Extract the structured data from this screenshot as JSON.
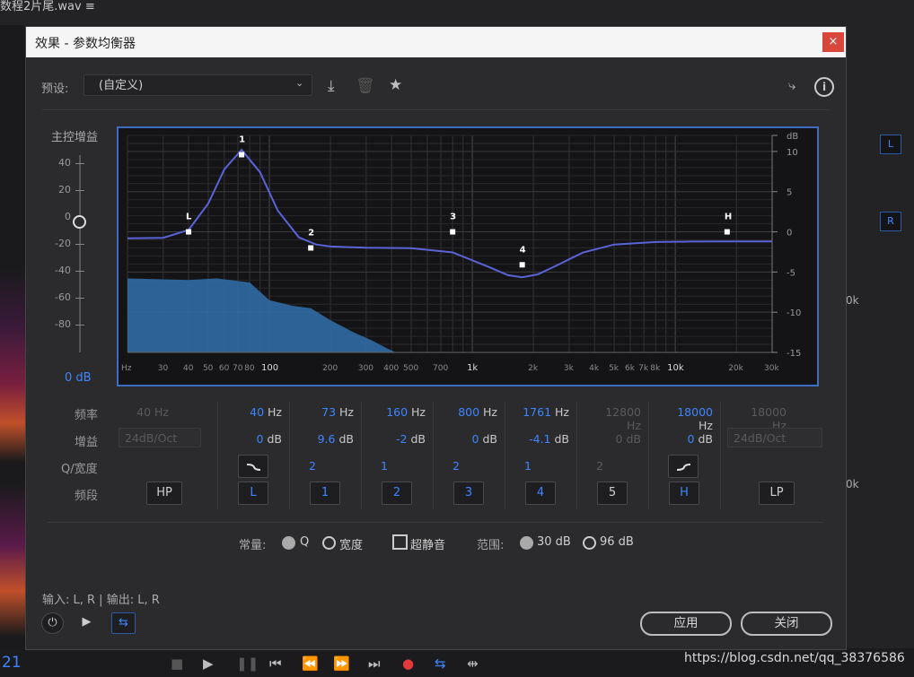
{
  "background": {
    "file_title": "数程2片尾.wav ≡",
    "counter": "21",
    "right_badges": [
      "L",
      "R"
    ],
    "right_values": [
      "0k",
      "0k"
    ],
    "transport": [
      "■",
      "▶",
      "❚❚",
      "⏮",
      "⏪",
      "⏩",
      "⏭",
      "●",
      "⇆",
      "⇹"
    ],
    "watermark": "https://blog.csdn.net/qq_38376586"
  },
  "dialog": {
    "title": "效果 - 参数均衡器",
    "close_label": "×",
    "preset_label": "预设:",
    "preset_value": "(自定义)",
    "master_gain_label": "主控增益",
    "master_ticks": [
      "40",
      "20",
      "0",
      "-20",
      "-40",
      "-60",
      "-80"
    ],
    "master_value": "0 dB"
  },
  "graph": {
    "freq_ticks": [
      "Hz",
      "30",
      "40",
      "50",
      "60",
      "70",
      "80",
      "100",
      "200",
      "300",
      "400",
      "500",
      "700",
      "1k",
      "2k",
      "3k",
      "4k",
      "5k",
      "6k",
      "7k",
      "8k",
      "10k",
      "20k",
      "30k"
    ],
    "db_ticks": [
      "dB",
      "10",
      "5",
      "0",
      "-5",
      "-10",
      "-15"
    ],
    "nodes": [
      {
        "label": "L",
        "freq_hz": 40,
        "gain_db": 0
      },
      {
        "label": "1",
        "freq_hz": 73,
        "gain_db": 9.6
      },
      {
        "label": "2",
        "freq_hz": 160,
        "gain_db": -2
      },
      {
        "label": "3",
        "freq_hz": 800,
        "gain_db": 0
      },
      {
        "label": "4",
        "freq_hz": 1761,
        "gain_db": -4.1
      },
      {
        "label": "H",
        "freq_hz": 18000,
        "gain_db": 0
      }
    ],
    "colors": {
      "curve": "#5a63d8",
      "spectrum": "#2f6aa3",
      "frame": "#3e6ec1",
      "node": "#ffffff"
    }
  },
  "params": {
    "row_labels": [
      "频率",
      "增益",
      "Q/宽度",
      "频段"
    ],
    "hp": {
      "freq": "40 Hz",
      "slope": "24dB/Oct",
      "band": "HP"
    },
    "lp": {
      "freq": "18000 Hz",
      "slope": "24dB/Oct",
      "band": "LP"
    },
    "bands": [
      {
        "freq": "40",
        "gain": "0",
        "q": "",
        "band": "L",
        "active": true
      },
      {
        "freq": "73",
        "gain": "9.6",
        "q": "2",
        "band": "1",
        "active": true
      },
      {
        "freq": "160",
        "gain": "-2",
        "q": "1",
        "band": "2",
        "active": true
      },
      {
        "freq": "800",
        "gain": "0",
        "q": "2",
        "band": "3",
        "active": true
      },
      {
        "freq": "1761",
        "gain": "-4.1",
        "q": "1",
        "band": "4",
        "active": true
      },
      {
        "freq": "12800",
        "gain": "0",
        "q": "2",
        "band": "5",
        "active": false
      },
      {
        "freq": "18000",
        "gain": "0",
        "q": "",
        "band": "H",
        "active": true
      }
    ],
    "hz_unit": "Hz",
    "db_unit": "dB"
  },
  "options": {
    "constant_label": "常量:",
    "q_label": "Q",
    "width_label": "宽度",
    "ultra_quiet_label": "超静音",
    "range_label": "范围:",
    "range_30": "30 dB",
    "range_96": "96 dB"
  },
  "footer": {
    "io_label": "输入: L, R | 输出: L, R",
    "apply_label": "应用",
    "close_label": "关闭"
  }
}
